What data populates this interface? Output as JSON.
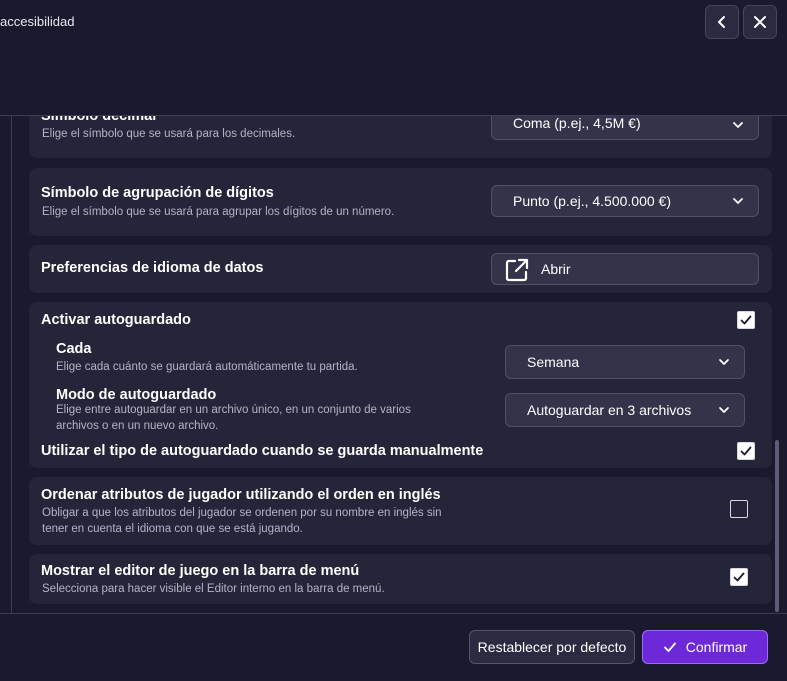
{
  "header": {
    "title": "accesibilidad",
    "back_icon": "chevron-left-icon",
    "close_icon": "close-icon"
  },
  "settings": {
    "decimal": {
      "title": "Símbolo decimal",
      "desc": "Elige el símbolo que se usará para los decimales.",
      "value": "Coma (p.ej., 4,5M €)"
    },
    "grouping": {
      "title": "Símbolo de agrupación de dígitos",
      "desc": "Elige el símbolo que se usará para agrupar los dígitos de un número.",
      "value": "Punto (p.ej., 4.500.000 €)"
    },
    "data_language": {
      "title": "Preferencias de idioma de datos",
      "button": "Abrir",
      "icon": "external-link-icon"
    },
    "autosave": {
      "title": "Activar autoguardado",
      "checked": true,
      "every": {
        "title": "Cada",
        "desc": "Elige cada cuánto se guardará automáticamente tu partida.",
        "value": "Semana"
      },
      "mode": {
        "title": "Modo de autoguardado",
        "desc": "Elige entre autoguardar en un archivo único, en un conjunto de varios archivos o en un nuevo archivo.",
        "value": "Autoguardar en 3 archivos"
      },
      "manual": {
        "title": "Utilizar el tipo de autoguardado cuando se guarda manualmente",
        "checked": true
      }
    },
    "english_order": {
      "title": "Ordenar atributos de jugador utilizando el orden en inglés",
      "desc": "Obligar a que los atributos del jugador se ordenen por su nombre en inglés sin tener en cuenta el idioma con que se está jugando.",
      "checked": false
    },
    "editor_menu": {
      "title": "Mostrar el editor de juego en la barra de menú",
      "desc": "Selecciona para hacer visible el Editor interno en la barra de menú.",
      "checked": true
    }
  },
  "footer": {
    "reset_label": "Restablecer por defecto",
    "confirm_label": "Confirmar",
    "confirm_icon": "check-icon"
  },
  "colors": {
    "background": "#1a1a2e",
    "card": "#252539",
    "accent": "#6d28d9"
  }
}
